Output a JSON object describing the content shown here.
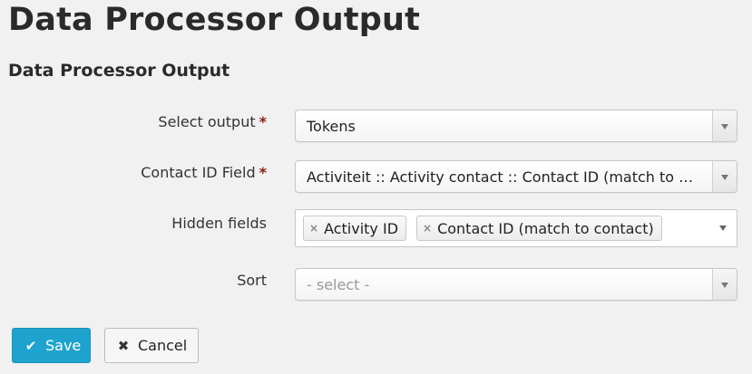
{
  "page": {
    "title": "Data Processor Output",
    "section_title": "Data Processor Output"
  },
  "form": {
    "select_output": {
      "label": "Select output",
      "required_mark": "*",
      "value": "Tokens"
    },
    "contact_id_field": {
      "label": "Contact ID Field",
      "required_mark": "*",
      "value": "Activiteit :: Activity contact :: Contact ID (match to c..."
    },
    "hidden_fields": {
      "label": "Hidden fields",
      "chips": [
        {
          "label": "Activity ID",
          "remove_icon": "×"
        },
        {
          "label": "Contact ID (match to contact)",
          "remove_icon": "×"
        }
      ]
    },
    "sort": {
      "label": "Sort",
      "placeholder": "- select -"
    }
  },
  "buttons": {
    "save": {
      "label": "Save",
      "icon": "✔",
      "icon_name": "check-icon",
      "color": "#1ea3cf"
    },
    "cancel": {
      "label": "Cancel",
      "icon": "✖",
      "icon_name": "close-icon"
    }
  }
}
